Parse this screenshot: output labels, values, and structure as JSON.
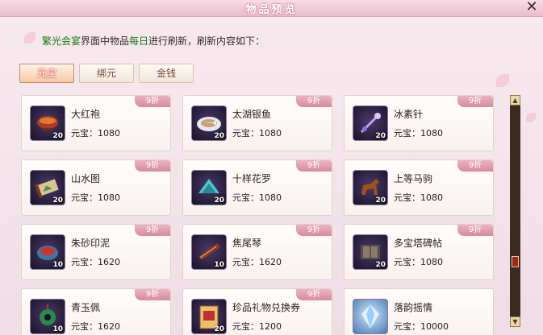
{
  "window": {
    "title": "物品预览",
    "close_label": "✕"
  },
  "intro": {
    "prefix": "繁光会宴",
    "middle": "界面中物品",
    "daily": "每日",
    "suffix": "进行刷新，刷新内容如下："
  },
  "tabs": [
    {
      "label": "元宝",
      "active": true
    },
    {
      "label": "绑元",
      "active": false
    },
    {
      "label": "金钱",
      "active": false
    }
  ],
  "items": [
    {
      "name": "大红袍",
      "price_label": "元宝：1080",
      "discount": "9折",
      "qty": "20",
      "icon": "tea-bowl-icon"
    },
    {
      "name": "太湖银鱼",
      "price_label": "元宝：1080",
      "discount": "9折",
      "qty": "20",
      "icon": "fish-dish-icon"
    },
    {
      "name": "冰素针",
      "price_label": "元宝：1080",
      "discount": "9折",
      "qty": "20",
      "icon": "needle-icon"
    },
    {
      "name": "山水图",
      "price_label": "元宝：1080",
      "discount": "9折",
      "qty": "20",
      "icon": "scroll-icon"
    },
    {
      "name": "十样花罗",
      "price_label": "元宝：1080",
      "discount": "9折",
      "qty": "20",
      "icon": "silk-icon"
    },
    {
      "name": "上等马驹",
      "price_label": "元宝：1080",
      "discount": "9折",
      "qty": "20",
      "icon": "horse-icon"
    },
    {
      "name": "朱砂印泥",
      "price_label": "元宝：1620",
      "discount": "9折",
      "qty": "10",
      "icon": "inkpad-icon"
    },
    {
      "name": "焦尾琴",
      "price_label": "元宝：1620",
      "discount": "9折",
      "qty": "10",
      "icon": "zither-icon"
    },
    {
      "name": "多宝塔碑帖",
      "price_label": "元宝：1080",
      "discount": "9折",
      "qty": "20",
      "icon": "book-icon"
    },
    {
      "name": "青玉佩",
      "price_label": "元宝：1620",
      "discount": "9折",
      "qty": "10",
      "icon": "jade-pendant-icon"
    },
    {
      "name": "珍品礼物兑换券",
      "price_label": "元宝：1200",
      "discount": "9折",
      "qty": "20",
      "icon": "voucher-icon"
    },
    {
      "name": "落韵摇情",
      "price_label": "元宝：10000",
      "discount": "",
      "qty": "",
      "icon": "crystal-icon"
    }
  ],
  "colors": {
    "accent": "#d88aa2",
    "highlight_green": "#1a7a1a"
  }
}
